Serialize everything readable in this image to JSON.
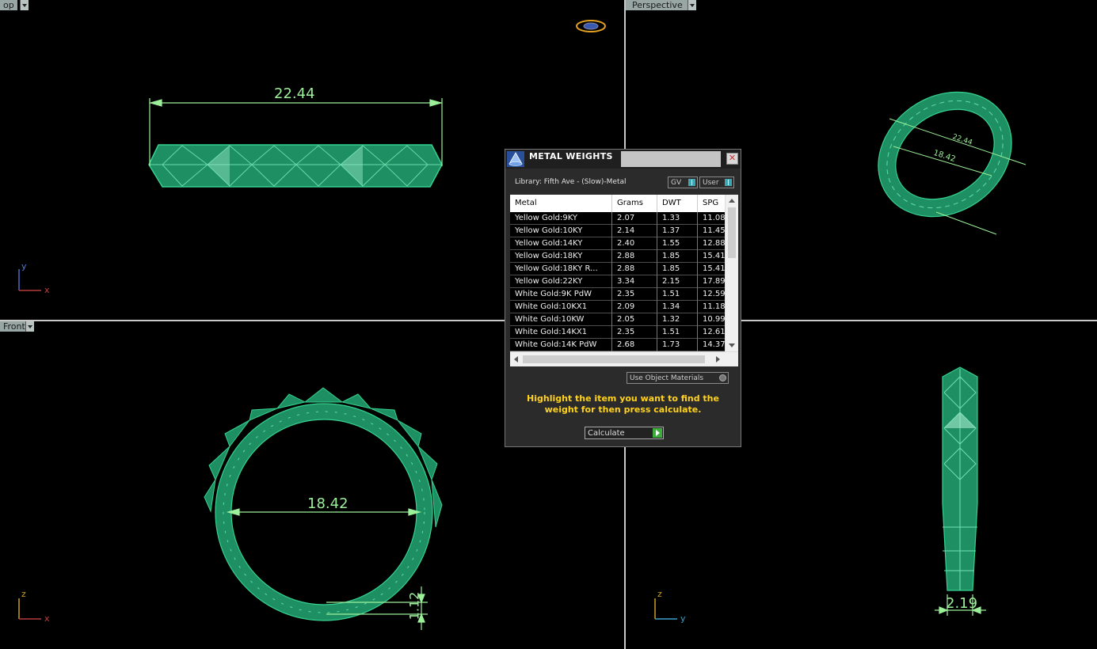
{
  "viewports": {
    "top": {
      "label": "op",
      "dimension": "22.44",
      "axis_a": "y",
      "axis_b": "x"
    },
    "perspective": {
      "label": "Perspective",
      "dim_outer": "22.44",
      "dim_inner": "18.42"
    },
    "front": {
      "label": "Front",
      "dimension": "18.42",
      "thickness": "1.12",
      "axis_a": "z",
      "axis_b": "x"
    },
    "side": {
      "dimension": "2.19",
      "axis_a": "z",
      "axis_b": "y"
    }
  },
  "dialog": {
    "title": "METAL WEIGHTS",
    "library": "Library: Fifth Ave - (Slow)-Metal",
    "gv_label": "GV",
    "user_label": "User",
    "columns": [
      "Metal",
      "Grams",
      "DWT",
      "SPG"
    ],
    "rows": [
      [
        "Yellow Gold:9KY",
        "2.07",
        "1.33",
        "11.08"
      ],
      [
        "Yellow Gold:10KY",
        "2.14",
        "1.37",
        "11.45"
      ],
      [
        "Yellow Gold:14KY",
        "2.40",
        "1.55",
        "12.88"
      ],
      [
        "Yellow Gold:18KY",
        "2.88",
        "1.85",
        "15.41"
      ],
      [
        "Yellow Gold:18KY R...",
        "2.88",
        "1.85",
        "15.41"
      ],
      [
        "Yellow Gold:22KY",
        "3.34",
        "2.15",
        "17.89"
      ],
      [
        "White Gold:9K PdW",
        "2.35",
        "1.51",
        "12.59"
      ],
      [
        "White Gold:10KX1",
        "2.09",
        "1.34",
        "11.18"
      ],
      [
        "White Gold:10KW",
        "2.05",
        "1.32",
        "10.99"
      ],
      [
        "White Gold:14KX1",
        "2.35",
        "1.51",
        "12.61"
      ],
      [
        "White Gold:14K PdW",
        "2.68",
        "1.73",
        "14.37"
      ]
    ],
    "use_object_materials": "Use Object Materials",
    "hint": "Highlight the item you want to find the weight for then press calculate.",
    "calculate": "Calculate",
    "close": "✕"
  },
  "colors": {
    "ring": "#1e8f63",
    "ring_line": "#35d28f",
    "dim": "#9df09a",
    "hint": "#ffd21e"
  }
}
